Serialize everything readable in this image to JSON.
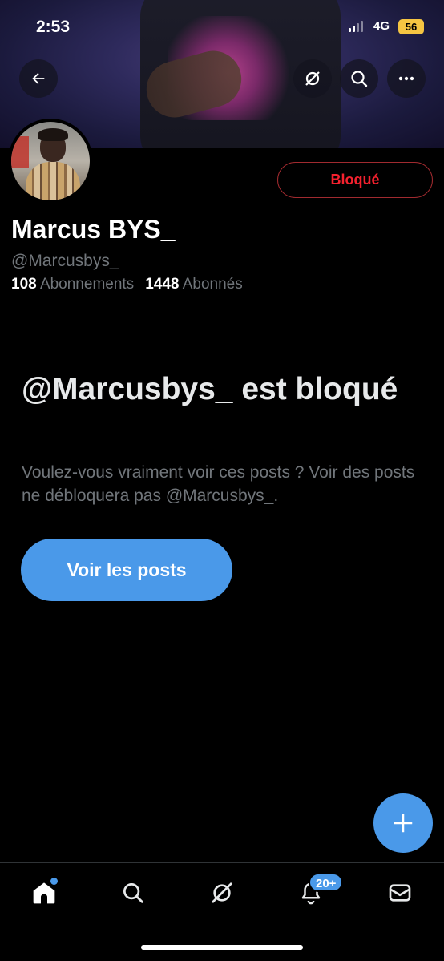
{
  "status_bar": {
    "time": "2:53",
    "network": "4G",
    "battery": "56"
  },
  "profile": {
    "name": "Marcus BYS_",
    "handle": "@Marcusbys_",
    "following_count": "108",
    "following_label": "Abonnements",
    "followers_count": "1448",
    "followers_label": "Abonnés",
    "blocked_button_label": "Bloqué"
  },
  "blocked_notice": {
    "title": "@Marcusbys_ est bloqué",
    "description": "Voulez-vous vraiment voir ces posts ? Voir des posts ne débloquera pas @Marcusbys_.",
    "button_label": "Voir les posts"
  },
  "tab_bar": {
    "items": [
      {
        "name": "home",
        "icon": "home-icon",
        "active": true
      },
      {
        "name": "search",
        "icon": "search-icon"
      },
      {
        "name": "grok",
        "icon": "grok-icon"
      },
      {
        "name": "notifications",
        "icon": "bell-icon",
        "badge": "20+"
      },
      {
        "name": "messages",
        "icon": "mail-icon"
      }
    ]
  },
  "colors": {
    "accent": "#4a99e9",
    "blocked_red": "#f4212e",
    "muted_text": "#71767b",
    "background": "#000000"
  }
}
